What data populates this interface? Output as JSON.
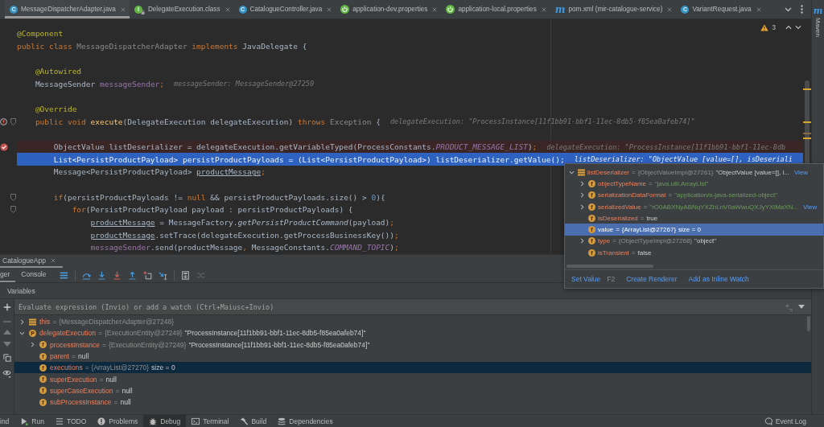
{
  "editor_tabs": [
    {
      "label": "MessageDispatcherAdapter.java",
      "kind": "class",
      "badge": "C",
      "selected": true
    },
    {
      "label": "DelegateExecution.class",
      "kind": "interface",
      "badge": "I",
      "selected": false
    },
    {
      "label": "CatalogueController.java",
      "kind": "class",
      "badge": "C",
      "selected": false
    },
    {
      "label": "application-dev.properties",
      "kind": "spring",
      "selected": false
    },
    {
      "label": "application-local.properties",
      "kind": "spring",
      "selected": false
    },
    {
      "label": "pom.xml (mir-catalogue-service)",
      "kind": "maven",
      "badge": "m",
      "selected": false
    },
    {
      "label": "VariantRequest.java",
      "kind": "class",
      "badge": "C",
      "selected": false
    }
  ],
  "side_strip": {
    "badge": "m",
    "label": "Maven"
  },
  "editor": {
    "problems": "3",
    "lines": [
      {
        "kind": "plain",
        "tokens": [
          {
            "kind": "annotation",
            "text": "@Component"
          }
        ]
      },
      {
        "kind": "plain",
        "tokens": [
          {
            "kind": "keyword",
            "text": "public class "
          },
          {
            "kind": "dim",
            "text": "MessageDispatcherAdapter"
          },
          {
            "kind": "keyword",
            "text": " implements "
          },
          {
            "kind": "plain",
            "text": "JavaDelegate {"
          }
        ]
      },
      {
        "kind": "plain"
      },
      {
        "kind": "plain",
        "tokens": [
          {
            "kind": "annotation",
            "text": "    @Autowired"
          }
        ]
      },
      {
        "kind": "plain",
        "tokens": [
          {
            "kind": "plain",
            "text": "    MessageSender "
          },
          {
            "kind": "field",
            "text": "messageSender"
          },
          {
            "kind": "keyword",
            "text": ";"
          }
        ],
        "hint": "messageSender: MessageSender@27250"
      },
      {
        "kind": "plain"
      },
      {
        "kind": "plain",
        "tokens": [
          {
            "kind": "annotation",
            "text": "    @Override"
          }
        ]
      },
      {
        "kind": "plain",
        "gutter": [
          {
            "kind": "override"
          },
          {
            "kind": "fold"
          }
        ],
        "tokens": [
          {
            "kind": "keyword",
            "text": "    public void "
          },
          {
            "kind": "method",
            "text": "execute"
          },
          {
            "kind": "plain",
            "text": "(DelegateExecution delegateExecution) "
          },
          {
            "kind": "keyword",
            "text": "throws "
          },
          {
            "kind": "dim",
            "text": "Exception"
          },
          {
            "kind": "plain",
            "text": " {"
          }
        ],
        "hint": "delegateExecution: \"ProcessInstance[11f1bb91-bbf1-11ec-8db5-f85ea0afeb74]\""
      },
      {
        "kind": "plain"
      },
      {
        "kind": "breakpoint",
        "gutter": [
          {
            "kind": "breakpoint"
          }
        ],
        "tokens": [
          {
            "kind": "plain",
            "text": "        ObjectValue listDeserializer = delegateExecution.getVariableTyped(ProcessConstants."
          },
          {
            "kind": "constant",
            "text": "PRODUCT_MESSAGE_LIST"
          },
          {
            "kind": "plain",
            "text": ")"
          },
          {
            "kind": "keyword",
            "text": ";"
          }
        ],
        "hint": "delegateExecution: \"ProcessInstance[11f1bb91-bbf1-11ec-8db"
      },
      {
        "kind": "current",
        "tokens": [
          {
            "kind": "plain",
            "text": "        List<PersistProductPayload> persistProductPayloads = (List<PersistProductPayload>) listDeserializer.getValue()"
          },
          {
            "kind": "keyword",
            "text": ";"
          }
        ],
        "hint": "listDeserializer: \"ObjectValue [value=[], isDeseriali"
      },
      {
        "kind": "plain",
        "tokens": [
          {
            "kind": "plain",
            "text": "        Message<PersistProductPayload> "
          },
          {
            "kind": "reassigned",
            "text": "productMessage"
          },
          {
            "kind": "keyword",
            "text": ";"
          }
        ]
      },
      {
        "kind": "plain"
      },
      {
        "kind": "plain",
        "gutter": [
          {
            "kind": "fold"
          }
        ],
        "tokens": [
          {
            "kind": "keyword",
            "text": "        if"
          },
          {
            "kind": "plain",
            "text": "(persistProductPayloads != "
          },
          {
            "kind": "keyword",
            "text": "null"
          },
          {
            "kind": "plain",
            "text": " && persistProductPayloads.size() > "
          },
          {
            "kind": "number",
            "text": "0"
          },
          {
            "kind": "plain",
            "text": "){"
          }
        ]
      },
      {
        "kind": "plain",
        "gutter": [
          {
            "kind": "fold"
          }
        ],
        "tokens": [
          {
            "kind": "keyword",
            "text": "            for"
          },
          {
            "kind": "plain",
            "text": "(PersistProductPayload payload : persistProductPayloads) {"
          }
        ]
      },
      {
        "kind": "plain",
        "tokens": [
          {
            "kind": "reassigned",
            "text": "                productMessage"
          },
          {
            "kind": "plain",
            "text": " = MessageFactory."
          },
          {
            "kind": "static",
            "text": "getPersistProductCommand"
          },
          {
            "kind": "plain",
            "text": "(payload)"
          },
          {
            "kind": "keyword",
            "text": ";"
          }
        ]
      },
      {
        "kind": "plain",
        "tokens": [
          {
            "kind": "reassigned",
            "text": "                productMessage"
          },
          {
            "kind": "plain",
            "text": ".setTrace(delegateExecution.getProcessBusinessKey())"
          },
          {
            "kind": "keyword",
            "text": ";"
          }
        ]
      },
      {
        "kind": "plain",
        "tokens": [
          {
            "kind": "field",
            "text": "                messageSender"
          },
          {
            "kind": "plain",
            "text": ".send(productMessage"
          },
          {
            "kind": "keyword",
            "text": ", "
          },
          {
            "kind": "plain",
            "text": "MessageConstants."
          },
          {
            "kind": "constant",
            "text": "COMMAND_TOPIC"
          },
          {
            "kind": "plain",
            "text": ")"
          },
          {
            "kind": "keyword",
            "text": ";"
          }
        ]
      }
    ]
  },
  "value_popup": {
    "rows": [
      {
        "name": "listDeserializer",
        "kind": "object",
        "expanded": true,
        "selected": false,
        "operator": "=",
        "type": "{ObjectValueImpl@27261}",
        "value": {
          "kind": "text",
          "text": "\"ObjectValue [value=[], i..."
        },
        "link": "View",
        "children": [
          {
            "name": "objectTypeName",
            "kind": "field",
            "badge": "f",
            "expanded": false,
            "selected": false,
            "operator": "=",
            "value": {
              "kind": "string",
              "text": "\"java.util.ArrayList\""
            }
          },
          {
            "name": "serializationDataFormat",
            "kind": "field",
            "badge": "f",
            "expanded": false,
            "selected": false,
            "operator": "=",
            "value": {
              "kind": "string",
              "text": "\"application/x-java-serialized-object\""
            }
          },
          {
            "name": "serializedValue",
            "kind": "field",
            "badge": "f",
            "expanded": false,
            "selected": false,
            "operator": "=",
            "value": {
              "kind": "string",
              "text": "\"rO0ABXNyABNqYXZhLnV0aWwuQXJyYXlMaXN..."
            },
            "link": "View"
          },
          {
            "name": "isDeserialized",
            "kind": "field",
            "badge": "f",
            "selected": false,
            "operator": "=",
            "value": {
              "kind": "text",
              "text": "true"
            }
          },
          {
            "name": "value",
            "kind": "field",
            "badge": "f",
            "selected": true,
            "operator": "=",
            "type": "{ArrayList@27267}",
            "value": {
              "kind": "text",
              "text": "size = 0"
            }
          },
          {
            "name": "type",
            "kind": "field",
            "badge": "f",
            "expanded": false,
            "selected": false,
            "operator": "=",
            "type": "{ObjectTypeImpl@27268}",
            "value": {
              "kind": "text",
              "text": "\"object\""
            }
          },
          {
            "name": "isTransient",
            "kind": "field",
            "badge": "f",
            "selected": false,
            "operator": "=",
            "value": {
              "kind": "text",
              "text": "false"
            }
          }
        ]
      }
    ],
    "actions": [
      {
        "label": "Set Value",
        "shortcut": "F2"
      },
      {
        "label": "Create Renderer"
      },
      {
        "label": "Add as Inline Watch"
      }
    ]
  },
  "debug_panel": {
    "session": {
      "label": "CatalogueApp",
      "selected": true
    },
    "tabs": [
      {
        "label": "ger",
        "selected": true
      },
      {
        "label": "Console",
        "selected": false
      }
    ],
    "toolbar": [
      {
        "kind": "layout",
        "disabled": false
      },
      {
        "kind": "step-over",
        "disabled": false
      },
      {
        "kind": "step-into",
        "disabled": false
      },
      {
        "kind": "force-step-into",
        "disabled": false
      },
      {
        "kind": "step-out",
        "disabled": false
      },
      {
        "kind": "drop-frame",
        "disabled": false
      },
      {
        "kind": "run-to-cursor",
        "disabled": false
      },
      {
        "kind": "evaluate",
        "disabled": false
      },
      {
        "kind": "trace",
        "disabled": true
      }
    ],
    "section": "Variables",
    "watch_field": {
      "placeholder": "Evaluate expression (Invio) or add a watch (Ctrl+Maiusc+Invio)"
    },
    "side_tools": [
      {
        "kind": "add",
        "disabled": false
      },
      {
        "kind": "remove",
        "disabled": true
      },
      {
        "kind": "up",
        "disabled": true
      },
      {
        "kind": "down",
        "disabled": true
      },
      {
        "kind": "copy",
        "disabled": false
      },
      {
        "kind": "watches",
        "disabled": false
      }
    ],
    "variables": [
      {
        "name": "this",
        "kind": "object",
        "expanded": false,
        "selected": false,
        "operator": "=",
        "type": "{MessageDispatcherAdapter@27248}"
      },
      {
        "name": "delegateExecution",
        "kind": "parameter",
        "badge": "P",
        "expanded": true,
        "selected": false,
        "operator": "=",
        "type": "{ExecutionEntity@27249}",
        "value": {
          "kind": "text",
          "text": "\"ProcessInstance[11f1bb91-bbf1-11ec-8db5-f85ea0afeb74]\""
        },
        "children": [
          {
            "name": "processInstance",
            "kind": "field",
            "badge": "f",
            "expanded": false,
            "selected": false,
            "operator": "=",
            "type": "{ExecutionEntity@27249}",
            "value": {
              "kind": "text",
              "text": "\"ProcessInstance[11f1bb91-bbf1-11ec-8db5-f85ea0afeb74]\""
            }
          },
          {
            "name": "parent",
            "kind": "field",
            "badge": "f",
            "selected": false,
            "operator": "=",
            "value": {
              "kind": "text",
              "text": "null"
            }
          },
          {
            "name": "executions",
            "kind": "field",
            "badge": "f",
            "selected": true,
            "operator": "=",
            "type": "{ArrayList@27270}",
            "value": {
              "kind": "text",
              "text": "size = 0"
            }
          },
          {
            "name": "superExecution",
            "kind": "field",
            "badge": "f",
            "selected": false,
            "operator": "=",
            "value": {
              "kind": "text",
              "text": "null"
            }
          },
          {
            "name": "superCaseExecution",
            "kind": "field",
            "badge": "f",
            "selected": false,
            "operator": "=",
            "value": {
              "kind": "text",
              "text": "null"
            }
          },
          {
            "name": "subProcessInstance",
            "kind": "field",
            "badge": "f",
            "selected": false,
            "operator": "=",
            "value": {
              "kind": "text",
              "text": "null"
            }
          }
        ]
      }
    ]
  },
  "tool_windows": [
    {
      "label": "ind",
      "kind": "find",
      "selected": false
    },
    {
      "label": "Run",
      "kind": "run",
      "selected": false
    },
    {
      "label": "TODO",
      "kind": "todo",
      "selected": false
    },
    {
      "label": "Problems",
      "kind": "problems",
      "selected": false
    },
    {
      "label": "Debug",
      "kind": "debug",
      "selected": true
    },
    {
      "label": "Terminal",
      "kind": "terminal",
      "selected": false
    },
    {
      "label": "Build",
      "kind": "build",
      "selected": false
    },
    {
      "label": "Dependencies",
      "kind": "dependencies",
      "selected": false
    }
  ],
  "event_log": "Event Log"
}
